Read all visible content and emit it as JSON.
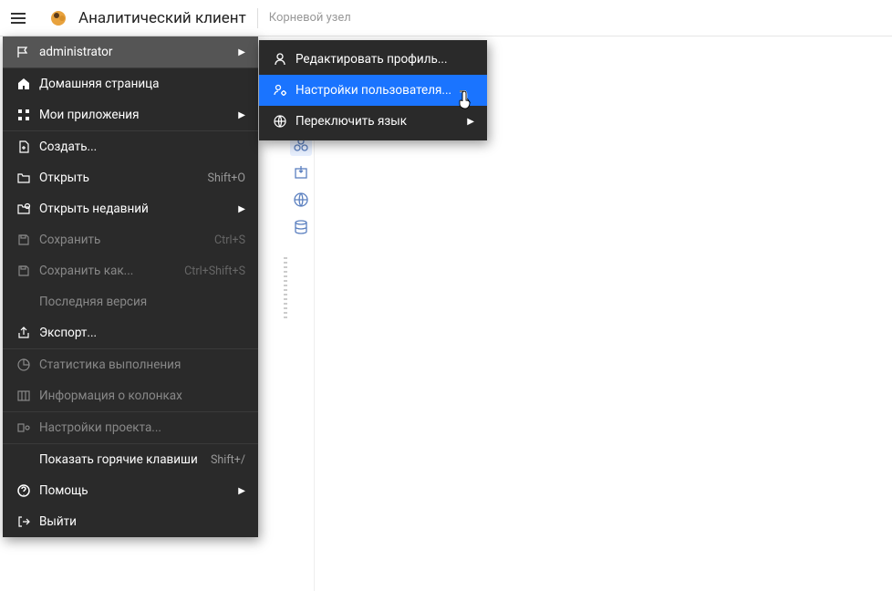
{
  "header": {
    "title": "Аналитический клиент",
    "breadcrumb": "Корневой узел"
  },
  "menu": {
    "user": "administrator",
    "home": "Домашняя страница",
    "apps": "Мои приложения",
    "create": "Создать...",
    "open": {
      "label": "Открыть",
      "shortcut": "Shift+O"
    },
    "open_recent": "Открыть недавний",
    "save": {
      "label": "Сохранить",
      "shortcut": "Ctrl+S"
    },
    "save_as": {
      "label": "Сохранить как...",
      "shortcut": "Ctrl+Shift+S"
    },
    "last_version": "Последняя версия",
    "export": "Экспорт...",
    "exec_stats": "Статистика выполнения",
    "col_info": "Информация о колонках",
    "project_settings": "Настройки проекта...",
    "hotkeys": {
      "label": "Показать горячие клавиши",
      "shortcut": "Shift+/"
    },
    "help": "Помощь",
    "exit": "Выйти"
  },
  "submenu": {
    "edit_profile": "Редактировать профиль...",
    "user_settings": "Настройки пользователя...",
    "switch_lang": "Переключить язык"
  }
}
